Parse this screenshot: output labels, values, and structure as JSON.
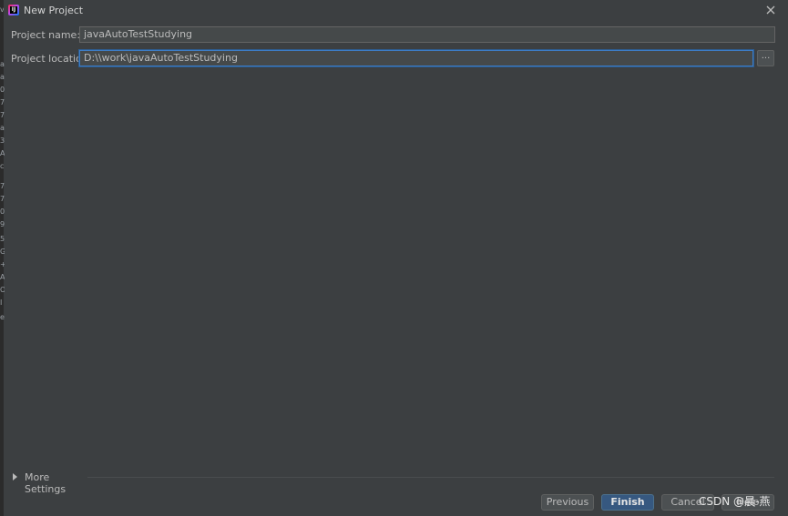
{
  "window": {
    "title": "New Project",
    "app_icon_label": "IJ"
  },
  "form": {
    "project_name_label": "Project name:",
    "project_name_value": "javaAutoTestStudying",
    "project_location_label": "Project location:",
    "project_location_value": "D:\\\\work\\javaAutoTestStudying",
    "browse_label": "..."
  },
  "more_settings": {
    "label": "More Settings"
  },
  "buttons": {
    "previous": "Previous",
    "finish": "Finish",
    "cancel": "Cancel",
    "help": "Help"
  },
  "left_edge_chars": [
    "v",
    "a",
    "a",
    "0",
    "7",
    "7",
    "a",
    "3",
    "A",
    "c",
    "7",
    "7",
    "0",
    "9",
    "5",
    "G",
    "+",
    "A",
    "O",
    "I",
    "e"
  ],
  "watermark": "CSDN @晨-燕",
  "colors": {
    "background": "#3c3f41",
    "accent": "#365880",
    "focus": "#3d7cc4"
  }
}
